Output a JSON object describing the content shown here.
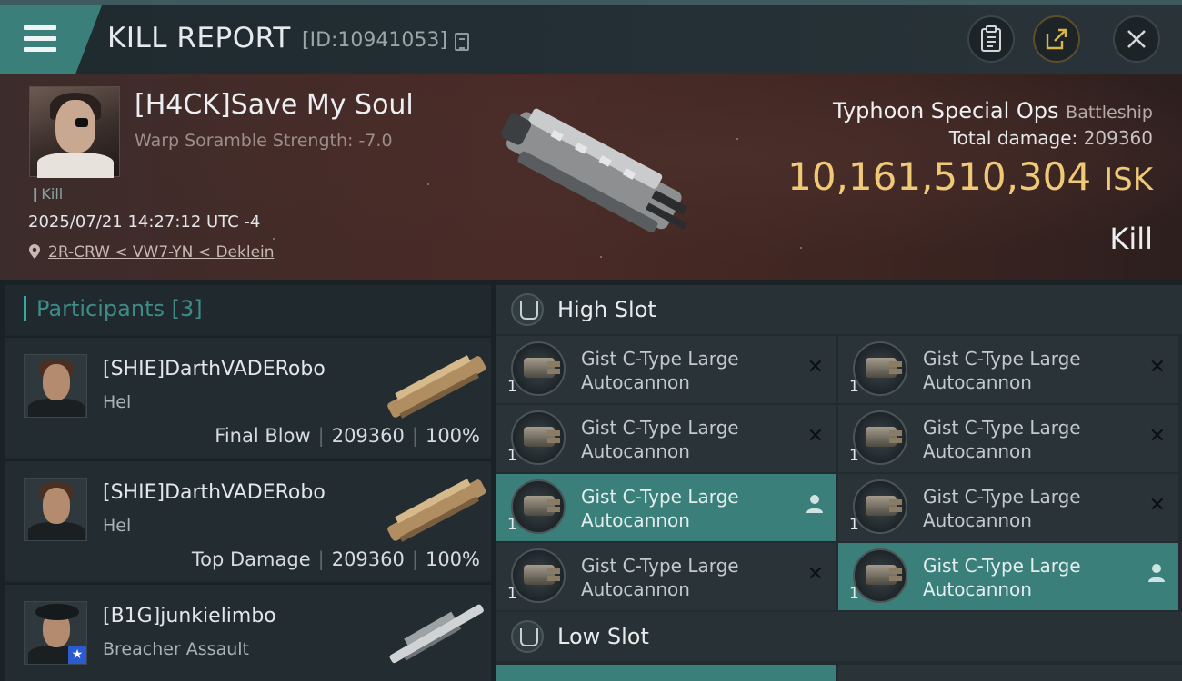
{
  "header": {
    "title": "KILL REPORT",
    "report_id": "[ID:10941053]",
    "buttons": [
      "clipboard-icon",
      "share-icon",
      "close-icon"
    ]
  },
  "victim": {
    "name": "[H4CK]Save My Soul",
    "scramble": "Warp Soramble Strength: -7.0",
    "tag": "Kill",
    "timestamp": "2025/07/21 14:27:12 UTC -4",
    "location": "2R-CRW < VW7-YN < Deklein",
    "ship_name": "Typhoon Special Ops",
    "ship_class": "Battleship",
    "total_damage_label": "Total damage:",
    "total_damage": "209360",
    "isk_value": "10,161,510,304",
    "isk_unit": "ISK",
    "result": "Kill"
  },
  "participants": {
    "label": "Participants",
    "count": "[3]",
    "rows": [
      {
        "name": "[SHIE]DarthVADERobo",
        "ship": "Hel",
        "role": "Final Blow",
        "damage": "209360",
        "percent": "100%"
      },
      {
        "name": "[SHIE]DarthVADERobo",
        "ship": "Hel",
        "role": "Top Damage",
        "damage": "209360",
        "percent": "100%"
      },
      {
        "name": "[B1G]junkielimbo",
        "ship": "Breacher Assault"
      }
    ]
  },
  "slots": {
    "high_label": "High Slot",
    "low_label": "Low Slot",
    "high_modules": [
      {
        "line1": "Gist C-Type Large",
        "line2": "Autocannon",
        "qty": "1",
        "status": "destroyed"
      },
      {
        "line1": "Gist C-Type Large",
        "line2": "Autocannon",
        "qty": "1",
        "status": "destroyed"
      },
      {
        "line1": "Gist C-Type Large",
        "line2": "Autocannon",
        "qty": "1",
        "status": "destroyed"
      },
      {
        "line1": "Gist C-Type Large",
        "line2": "Autocannon",
        "qty": "1",
        "status": "destroyed"
      },
      {
        "line1": "Gist C-Type Large",
        "line2": "Autocannon",
        "qty": "1",
        "status": "dropped"
      },
      {
        "line1": "Gist C-Type Large",
        "line2": "Autocannon",
        "qty": "1",
        "status": "destroyed"
      },
      {
        "line1": "Gist C-Type Large",
        "line2": "Autocannon",
        "qty": "1",
        "status": "destroyed"
      },
      {
        "line1": "Gist C-Type Large",
        "line2": "Autocannon",
        "qty": "1",
        "status": "dropped"
      }
    ]
  },
  "colors": {
    "accent": "#3b7f7a",
    "isk": "#f0c977",
    "banner": "#4a2a26"
  }
}
